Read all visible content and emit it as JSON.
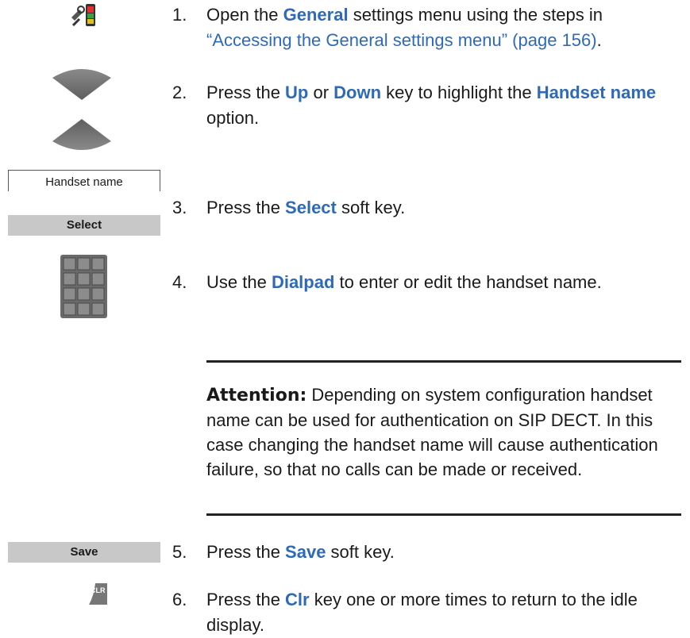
{
  "steps": [
    {
      "num": "1.",
      "pre": "Open the ",
      "kw": "General",
      "post": " settings menu using the steps in ",
      "link": "“Accessing the General settings menu” (page 156)",
      "end": "."
    },
    {
      "num": "2.",
      "pre": "Press the ",
      "kw1": "Up",
      "mid1": " or ",
      "kw2": "Down",
      "mid2": " key to highlight the ",
      "kw3": "Handset name",
      "post": " option."
    },
    {
      "num": "3.",
      "pre": "Press the ",
      "kw": "Select",
      "post": " soft key."
    },
    {
      "num": "4.",
      "pre": "Use the ",
      "kw": "Dialpad",
      "post": " to enter or edit the handset name."
    },
    {
      "num": "5.",
      "pre": "Press the ",
      "kw": "Save",
      "post": " soft key."
    },
    {
      "num": "6.",
      "pre": "Press the ",
      "kw": "Clr",
      "post": " key one or more times to return to the idle display."
    }
  ],
  "note": {
    "label": "Attention:",
    "text": " Depending on system configuration handset name can be used for authentication on SIP DECT. In this case changing the handset name will cause authentication failure, so that no calls can be made or received."
  },
  "display": {
    "handset_name": "Handset name",
    "select_softkey": "Select",
    "save_softkey": "Save"
  },
  "clr_key": {
    "label": "CLR"
  },
  "colors": {
    "keyword": "#2e6ab8",
    "softkey_bg": "#c8c8c8",
    "nav_key": "#7a7a7a"
  },
  "icons": [
    "settings-handset-icon",
    "navigation-up-down-icon",
    "dialpad-icon",
    "clr-key-icon"
  ]
}
